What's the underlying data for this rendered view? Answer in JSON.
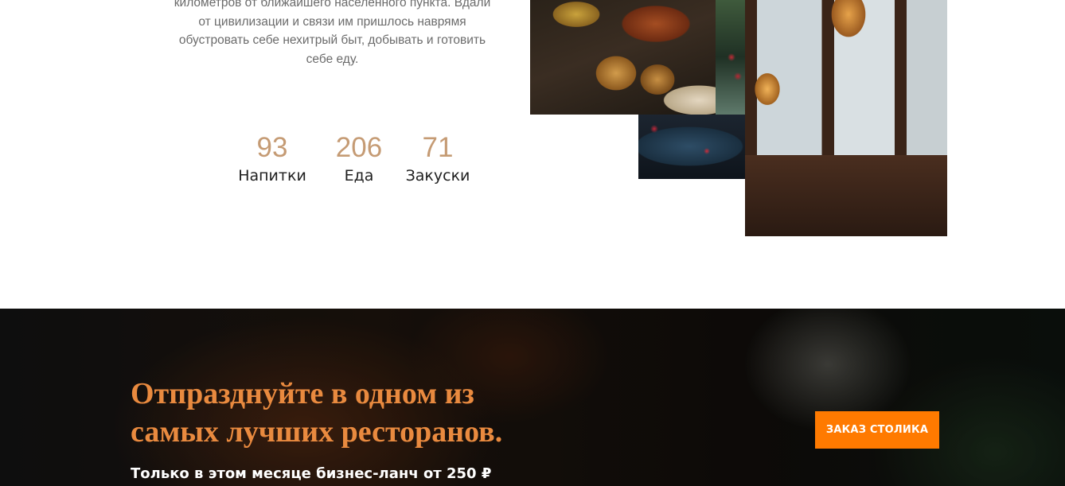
{
  "intro": {
    "lines": [
      "километров от ближайшего населенного пункта. Вдали",
      "от цивилизации и связи им пришлось наврямя",
      "обустровать себе нехитрый быт, добывать и готовить",
      "себе еду."
    ]
  },
  "stats": [
    {
      "value": "93",
      "label": "Напитки"
    },
    {
      "value": "206",
      "label": "Еда"
    },
    {
      "value": "71",
      "label": "Закуски"
    }
  ],
  "colors": {
    "accent": "#c59b74",
    "promo_title": "#e98a3f",
    "button": "#ff7a00"
  },
  "promo": {
    "title_line1": "Отпразднуйте в одном из",
    "title_line2": "самых лучших ресторанов.",
    "subtitle": "Только в этом месяце бизнес-ланч от 250 ₽",
    "button_label": "ЗАКАЗ СТОЛИКА"
  }
}
